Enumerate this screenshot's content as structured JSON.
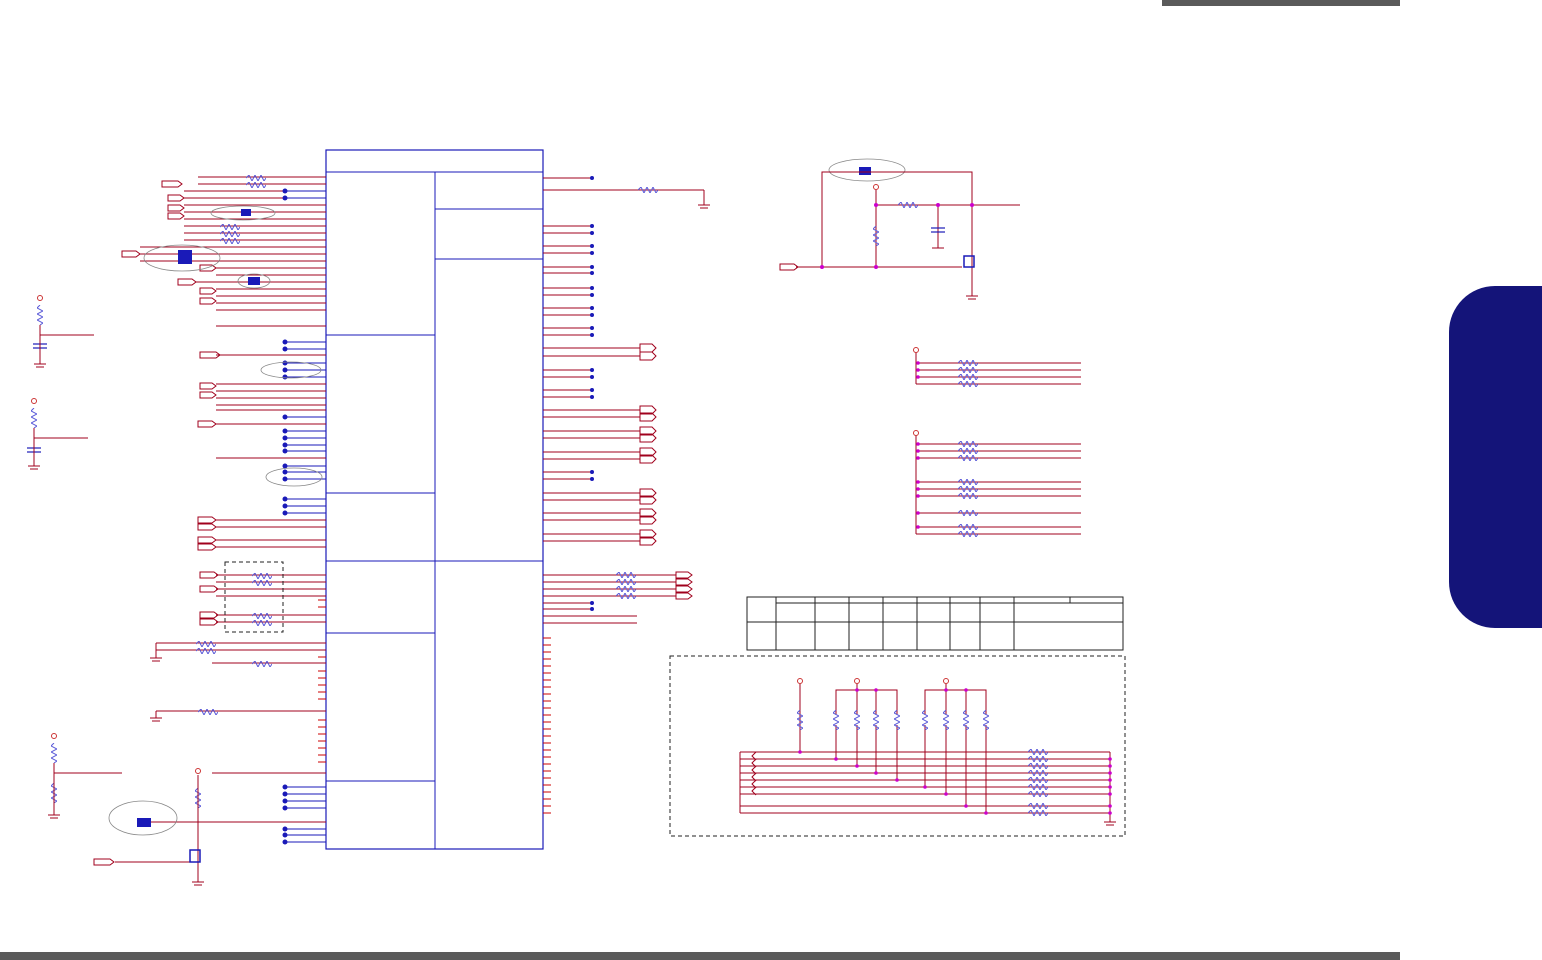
{
  "page": {
    "background": "#ffffff",
    "header_bar_color": "#5a5a5a",
    "footer_bar_color": "#5a5a5a",
    "side_tab_color": "#141479"
  },
  "schematic": {
    "wire_color": "#a0001c",
    "component_color": "#1a1ab8",
    "junction_color": "#1a1ab8",
    "pin_marker_color": "#cc00cc",
    "icons": [
      "resistor-icon",
      "capacitor-icon",
      "ground-icon",
      "power-rail-icon",
      "mosfet-icon",
      "jumper-icon",
      "net-port-icon"
    ]
  }
}
